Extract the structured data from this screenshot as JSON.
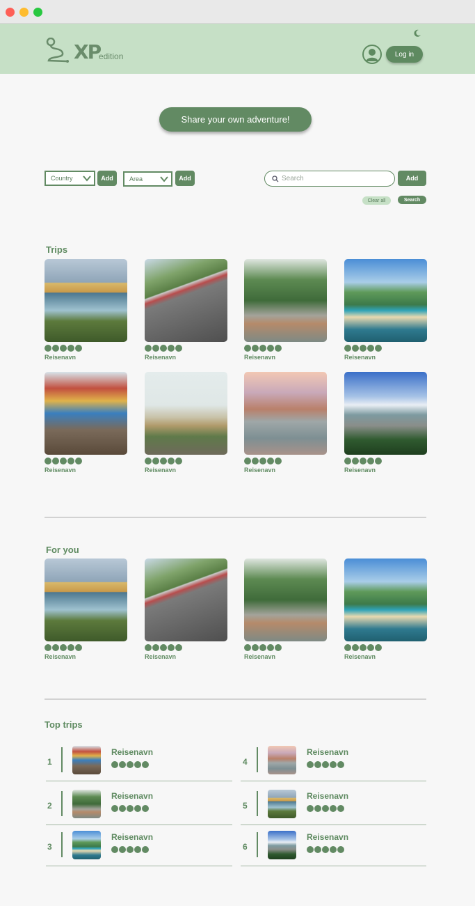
{
  "window": {
    "controls": [
      "close",
      "minimize",
      "maximize"
    ]
  },
  "header": {
    "logo_main": "XP",
    "logo_sub": "edition",
    "login_label": "Log in",
    "theme_icon": "moon-icon",
    "avatar_icon": "user-circle-icon"
  },
  "share_label": "Share your own adventure!",
  "filters": {
    "country_value": "Country",
    "country_add": "Add",
    "area_value": "Area",
    "area_add": "Add",
    "search_placeholder": "Search",
    "search_add": "Add",
    "clear_label": "Clear all",
    "search_label": "Search"
  },
  "trips": {
    "title": "Trips",
    "items": [
      {
        "name": "Reisenavn",
        "rating": 5
      },
      {
        "name": "Reisenavn",
        "rating": 5
      },
      {
        "name": "Reisenavn",
        "rating": 5
      },
      {
        "name": "Reisenavn",
        "rating": 5
      },
      {
        "name": "Reisenavn",
        "rating": 5
      },
      {
        "name": "Reisenavn",
        "rating": 5
      },
      {
        "name": "Reisenavn",
        "rating": 5
      },
      {
        "name": "Reisenavn",
        "rating": 5
      }
    ]
  },
  "for_you": {
    "title": "For you",
    "items": [
      {
        "name": "Reisenavn",
        "rating": 5
      },
      {
        "name": "Reisenavn",
        "rating": 5
      },
      {
        "name": "Reisenavn",
        "rating": 5
      },
      {
        "name": "Reisenavn",
        "rating": 5
      }
    ]
  },
  "top_trips": {
    "title": "Top trips",
    "items": [
      {
        "rank": "1",
        "name": "Reisenavn",
        "rating": 5
      },
      {
        "rank": "2",
        "name": "Reisenavn",
        "rating": 5
      },
      {
        "rank": "3",
        "name": "Reisenavn",
        "rating": 5
      },
      {
        "rank": "4",
        "name": "Reisenavn",
        "rating": 5
      },
      {
        "rank": "5",
        "name": "Reisenavn",
        "rating": 5
      },
      {
        "rank": "6",
        "name": "Reisenavn",
        "rating": 5
      }
    ]
  },
  "colors": {
    "accent": "#628a63",
    "header_bg": "#c6e0c6",
    "page_bg": "#f7f7f7"
  }
}
